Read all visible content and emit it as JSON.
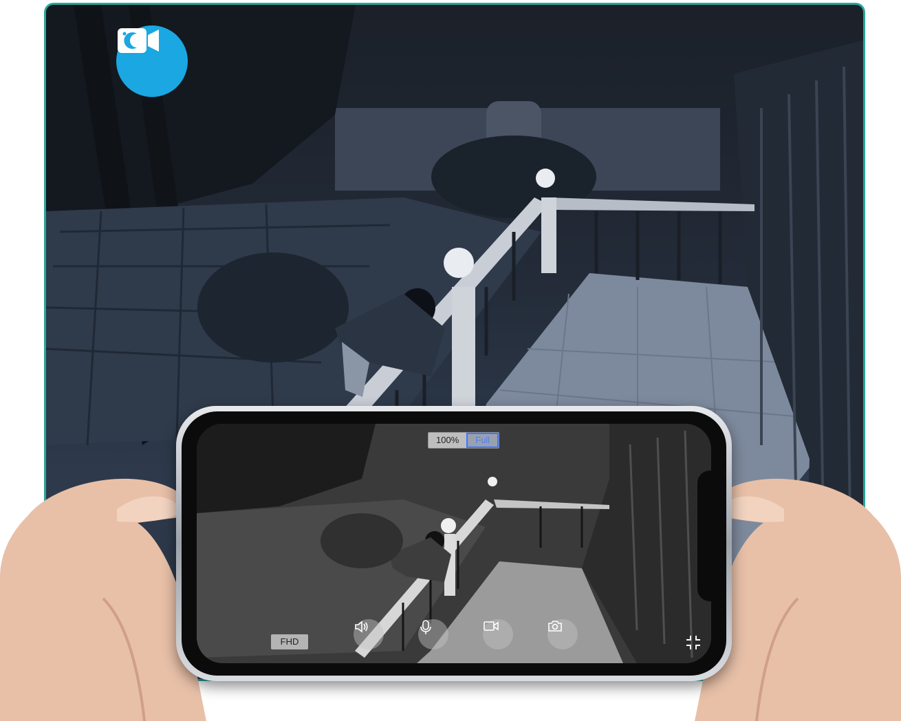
{
  "zoom": {
    "options": [
      {
        "label": "100%"
      },
      {
        "label": "Full"
      }
    ],
    "selected": "Full"
  },
  "quality": {
    "label": "FHD"
  },
  "controls": [
    {
      "name": "speaker",
      "icon": "speaker-icon"
    },
    {
      "name": "microphone",
      "icon": "microphone-icon"
    },
    {
      "name": "record",
      "icon": "video-camera-icon"
    },
    {
      "name": "snapshot",
      "icon": "camera-icon"
    }
  ],
  "badge": {
    "icon": "night-vision-camera-icon",
    "color": "#1aa7e2"
  },
  "colors": {
    "frame": "#2aa69a",
    "accent": "#3f76ff"
  }
}
